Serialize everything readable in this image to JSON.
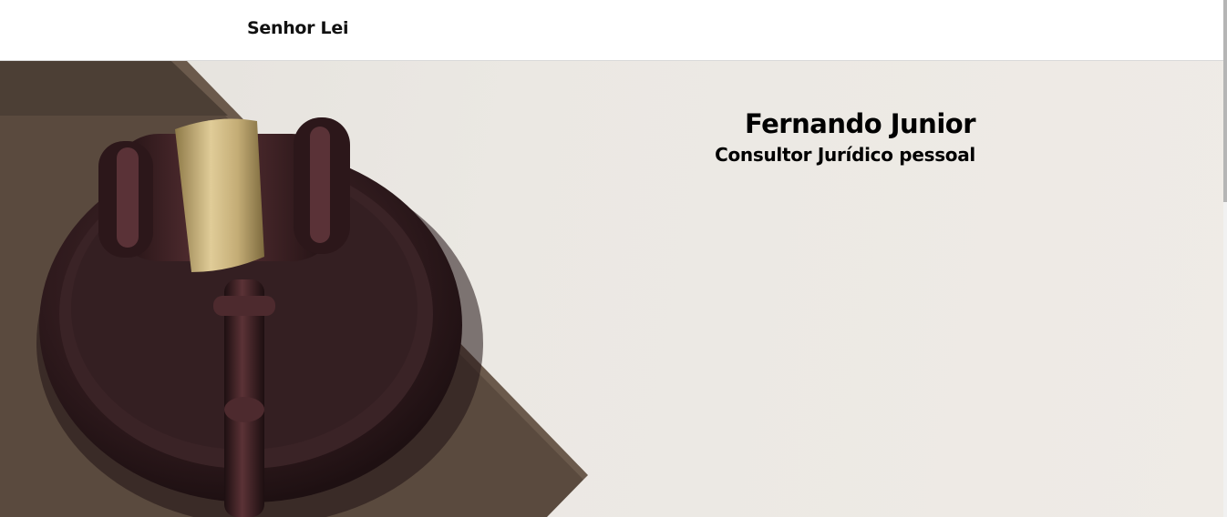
{
  "navbar": {
    "brand": "Senhor Lei"
  },
  "hero": {
    "title": "Fernando Junior",
    "subtitle": "Consultor Jurídico pessoal",
    "image_icon": "gavel-icon"
  },
  "colors": {
    "background": "#ffffff",
    "hero_background": "#ebe8e3",
    "text": "#000000",
    "wood": "#3a2326",
    "brass": "#c9b27a",
    "book": "#5a4a3e"
  }
}
